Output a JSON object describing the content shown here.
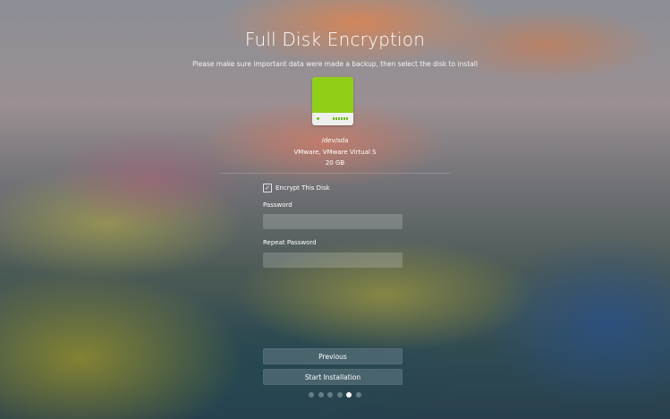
{
  "page": {
    "title": "Full Disk Encryption",
    "subtitle": "Please make sure important data were made a backup, then select the disk to install"
  },
  "disk": {
    "icon": "hard-disk-icon",
    "device": "/dev/sda",
    "model": "VMware, VMware Virtual S",
    "size": "20 GB",
    "color": "#8fcf17"
  },
  "form": {
    "encrypt_label": "Encrypt This Disk",
    "encrypt_checked": true,
    "password_label": "Password",
    "password_value": "",
    "repeat_password_label": "Repeat Password",
    "repeat_password_value": ""
  },
  "buttons": {
    "previous": "Previous",
    "start": "Start Installation"
  },
  "progress": {
    "total_steps": 6,
    "current_step": 5
  }
}
